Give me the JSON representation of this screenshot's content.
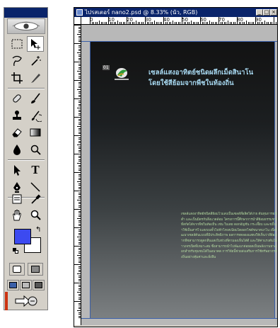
{
  "toolbox": {
    "logo_icon": "photoshop-eye-logo",
    "tools": [
      {
        "name": "marquee-tool",
        "icon": "dashed-rectangle"
      },
      {
        "name": "move-tool",
        "icon": "arrow-cross"
      },
      {
        "name": "lasso-tool",
        "icon": "lasso"
      },
      {
        "name": "magic-wand-tool",
        "icon": "wand-sparkle"
      },
      {
        "name": "crop-tool",
        "icon": "crop"
      },
      {
        "name": "slice-tool",
        "icon": "knife"
      },
      {
        "name": "healing-brush-tool",
        "icon": "bandage"
      },
      {
        "name": "brush-tool",
        "icon": "brush"
      },
      {
        "name": "clone-stamp-tool",
        "icon": "stamp"
      },
      {
        "name": "history-brush-tool",
        "icon": "history-brush"
      },
      {
        "name": "eraser-tool",
        "icon": "eraser"
      },
      {
        "name": "gradient-tool",
        "icon": "gradient"
      },
      {
        "name": "blur-tool",
        "icon": "drop"
      },
      {
        "name": "dodge-tool",
        "icon": "dodge"
      },
      {
        "name": "path-selection-tool",
        "icon": "black-arrow"
      },
      {
        "name": "type-tool",
        "icon": "letter-t"
      },
      {
        "name": "pen-tool",
        "icon": "pen-nib"
      },
      {
        "name": "line-tool",
        "icon": "diagonal-line"
      },
      {
        "name": "notes-tool",
        "icon": "note"
      },
      {
        "name": "eyedropper-tool",
        "icon": "eyedropper"
      },
      {
        "name": "hand-tool",
        "icon": "hand"
      },
      {
        "name": "zoom-tool",
        "icon": "magnifier"
      }
    ],
    "type_tool_glyph": "T",
    "foreground_color": "#3c4af0",
    "background_color": "#ffffff",
    "swap_glyph": "↰",
    "accent_red": "#cc3311"
  },
  "document": {
    "title": "ไปรสเตอร์ nano2.psd @ 8.33% (นัว, RGB)",
    "window_buttons": {
      "minimize": "_",
      "maximize": "□",
      "close": "×"
    },
    "ruler_labels": [
      "0",
      "10",
      "20",
      "30",
      "40",
      "50",
      "60",
      "70",
      "80",
      "90"
    ],
    "slice_badge": "01",
    "headline_lines": [
      "เซลล์แสงอาทิตย์ชนิดผลึกเม็ดสินาโน",
      "โดยใช้สีย้อมจากพืชในท้องถิ่น"
    ],
    "body_text": "เซลล์แสงอาทิตย์ชนิดสีย้อมไวแสงเป็นเซลล์ที่ผลิตได้ง่าย ต้นทุนการผลิตต่ำ และเป็นมิตรกับสิ่งแวดล้อม โครงการนี้ศึกษาการนำสีย้อมธรรมชาติที่สกัดได้จากพืชในท้องถิ่น เช่น ใบเตย ดอกอัญชัน กระเจี๊ยบ และขมิ้น มาใช้เป็นสารไวแสงบนขั้วไฟฟ้าไทเทเนียมไดออกไซด์ขนาดนาโน เพื่อพัฒนาเซลล์ต้นแบบที่มีประสิทธิภาพ ผลการทดลองแสดงให้เห็นว่าสีย้อมจากพืชสามารถดูดกลืนแสงในช่วงที่ตามองเห็นได้ดี และให้ค่าแรงดันไฟฟ้าวงจรเปิดที่เหมาะสม ซึ่งสามารถนำไปพัฒนาต่อยอดเป็นพลังงานทางเลือกสำหรับชุมชนได้ในอนาคต การวิจัยนี้ช่วยส่งเสริมการใช้ทรัพยากรท้องถิ่นอย่างคุ้มค่าและยั่งยืน"
  }
}
